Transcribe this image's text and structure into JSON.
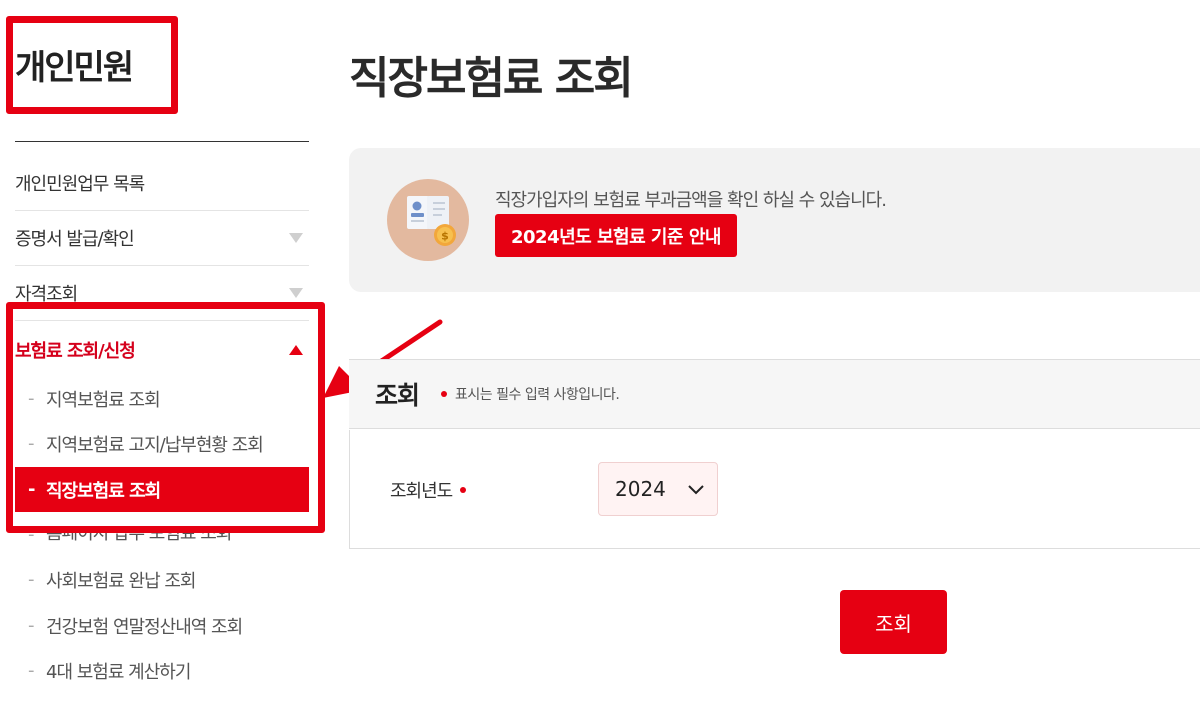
{
  "sidebar": {
    "title": "개인민원",
    "menu": [
      {
        "label": "개인민원업무 목록"
      },
      {
        "label": "증명서 발급/확인"
      },
      {
        "label": "자격조회"
      },
      {
        "label": "보험료 조회/신청"
      }
    ],
    "submenu": [
      {
        "label": "지역보험료 조회"
      },
      {
        "label": "지역보험료 고지/납부현황 조회"
      },
      {
        "label": "직장보험료 조회"
      },
      {
        "label": "홈페이지 납부 보험료 조회"
      },
      {
        "label": "사회보험료 완납 조회"
      },
      {
        "label": "건강보험 연말정산내역 조회"
      },
      {
        "label": "4대 보험료 계산하기"
      }
    ],
    "dash": "-"
  },
  "main": {
    "title": "직장보험료 조회",
    "info": {
      "text": "직장가입자의 보험료 부과금액을 확인 하실 수 있습니다.",
      "button_label": "2024년도 보험료 기준 안내"
    },
    "search": {
      "heading": "조회",
      "required_note": "표시는 필수 입력 사항입니다.",
      "year_label": "조회년도",
      "year_value": "2024",
      "submit_label": "조회"
    }
  },
  "colors": {
    "accent": "#e60012",
    "active_text": "#d5001c"
  }
}
